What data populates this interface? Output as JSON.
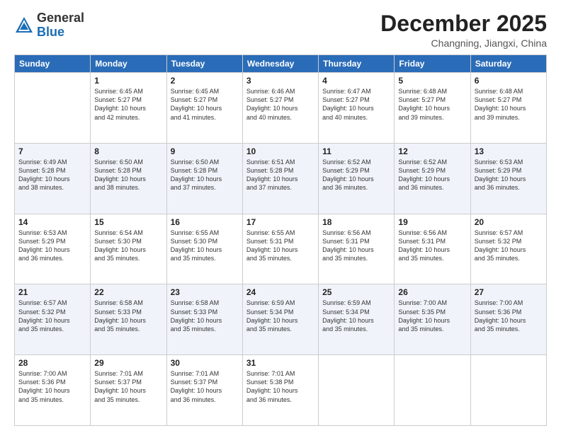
{
  "header": {
    "logo_general": "General",
    "logo_blue": "Blue",
    "month_title": "December 2025",
    "location": "Changning, Jiangxi, China"
  },
  "days_of_week": [
    "Sunday",
    "Monday",
    "Tuesday",
    "Wednesday",
    "Thursday",
    "Friday",
    "Saturday"
  ],
  "weeks": [
    [
      {
        "day": "",
        "info": ""
      },
      {
        "day": "1",
        "info": "Sunrise: 6:45 AM\nSunset: 5:27 PM\nDaylight: 10 hours\nand 42 minutes."
      },
      {
        "day": "2",
        "info": "Sunrise: 6:45 AM\nSunset: 5:27 PM\nDaylight: 10 hours\nand 41 minutes."
      },
      {
        "day": "3",
        "info": "Sunrise: 6:46 AM\nSunset: 5:27 PM\nDaylight: 10 hours\nand 40 minutes."
      },
      {
        "day": "4",
        "info": "Sunrise: 6:47 AM\nSunset: 5:27 PM\nDaylight: 10 hours\nand 40 minutes."
      },
      {
        "day": "5",
        "info": "Sunrise: 6:48 AM\nSunset: 5:27 PM\nDaylight: 10 hours\nand 39 minutes."
      },
      {
        "day": "6",
        "info": "Sunrise: 6:48 AM\nSunset: 5:27 PM\nDaylight: 10 hours\nand 39 minutes."
      }
    ],
    [
      {
        "day": "7",
        "info": "Sunrise: 6:49 AM\nSunset: 5:28 PM\nDaylight: 10 hours\nand 38 minutes."
      },
      {
        "day": "8",
        "info": "Sunrise: 6:50 AM\nSunset: 5:28 PM\nDaylight: 10 hours\nand 38 minutes."
      },
      {
        "day": "9",
        "info": "Sunrise: 6:50 AM\nSunset: 5:28 PM\nDaylight: 10 hours\nand 37 minutes."
      },
      {
        "day": "10",
        "info": "Sunrise: 6:51 AM\nSunset: 5:28 PM\nDaylight: 10 hours\nand 37 minutes."
      },
      {
        "day": "11",
        "info": "Sunrise: 6:52 AM\nSunset: 5:29 PM\nDaylight: 10 hours\nand 36 minutes."
      },
      {
        "day": "12",
        "info": "Sunrise: 6:52 AM\nSunset: 5:29 PM\nDaylight: 10 hours\nand 36 minutes."
      },
      {
        "day": "13",
        "info": "Sunrise: 6:53 AM\nSunset: 5:29 PM\nDaylight: 10 hours\nand 36 minutes."
      }
    ],
    [
      {
        "day": "14",
        "info": "Sunrise: 6:53 AM\nSunset: 5:29 PM\nDaylight: 10 hours\nand 36 minutes."
      },
      {
        "day": "15",
        "info": "Sunrise: 6:54 AM\nSunset: 5:30 PM\nDaylight: 10 hours\nand 35 minutes."
      },
      {
        "day": "16",
        "info": "Sunrise: 6:55 AM\nSunset: 5:30 PM\nDaylight: 10 hours\nand 35 minutes."
      },
      {
        "day": "17",
        "info": "Sunrise: 6:55 AM\nSunset: 5:31 PM\nDaylight: 10 hours\nand 35 minutes."
      },
      {
        "day": "18",
        "info": "Sunrise: 6:56 AM\nSunset: 5:31 PM\nDaylight: 10 hours\nand 35 minutes."
      },
      {
        "day": "19",
        "info": "Sunrise: 6:56 AM\nSunset: 5:31 PM\nDaylight: 10 hours\nand 35 minutes."
      },
      {
        "day": "20",
        "info": "Sunrise: 6:57 AM\nSunset: 5:32 PM\nDaylight: 10 hours\nand 35 minutes."
      }
    ],
    [
      {
        "day": "21",
        "info": "Sunrise: 6:57 AM\nSunset: 5:32 PM\nDaylight: 10 hours\nand 35 minutes."
      },
      {
        "day": "22",
        "info": "Sunrise: 6:58 AM\nSunset: 5:33 PM\nDaylight: 10 hours\nand 35 minutes."
      },
      {
        "day": "23",
        "info": "Sunrise: 6:58 AM\nSunset: 5:33 PM\nDaylight: 10 hours\nand 35 minutes."
      },
      {
        "day": "24",
        "info": "Sunrise: 6:59 AM\nSunset: 5:34 PM\nDaylight: 10 hours\nand 35 minutes."
      },
      {
        "day": "25",
        "info": "Sunrise: 6:59 AM\nSunset: 5:34 PM\nDaylight: 10 hours\nand 35 minutes."
      },
      {
        "day": "26",
        "info": "Sunrise: 7:00 AM\nSunset: 5:35 PM\nDaylight: 10 hours\nand 35 minutes."
      },
      {
        "day": "27",
        "info": "Sunrise: 7:00 AM\nSunset: 5:36 PM\nDaylight: 10 hours\nand 35 minutes."
      }
    ],
    [
      {
        "day": "28",
        "info": "Sunrise: 7:00 AM\nSunset: 5:36 PM\nDaylight: 10 hours\nand 35 minutes."
      },
      {
        "day": "29",
        "info": "Sunrise: 7:01 AM\nSunset: 5:37 PM\nDaylight: 10 hours\nand 35 minutes."
      },
      {
        "day": "30",
        "info": "Sunrise: 7:01 AM\nSunset: 5:37 PM\nDaylight: 10 hours\nand 36 minutes."
      },
      {
        "day": "31",
        "info": "Sunrise: 7:01 AM\nSunset: 5:38 PM\nDaylight: 10 hours\nand 36 minutes."
      },
      {
        "day": "",
        "info": ""
      },
      {
        "day": "",
        "info": ""
      },
      {
        "day": "",
        "info": ""
      }
    ]
  ]
}
